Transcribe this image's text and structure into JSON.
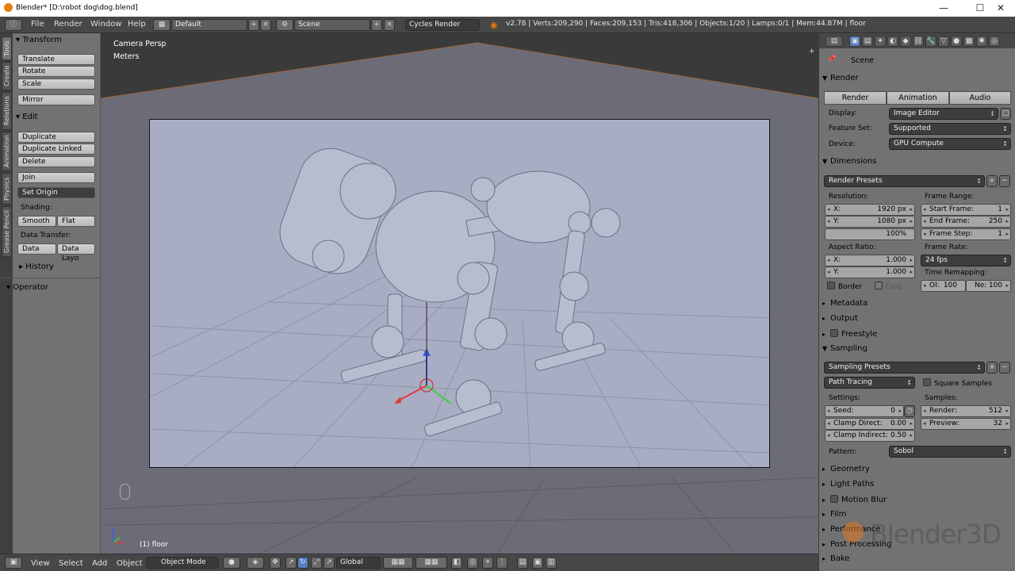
{
  "titlebar": {
    "title": "Blender* [D:\\robot dog\\dog.blend]",
    "minimize": "—",
    "maximize": "☐",
    "close": "✕"
  },
  "infobar": {
    "menus": [
      "File",
      "Render",
      "Window",
      "Help"
    ],
    "screen_layout": "Default",
    "scene": "Scene",
    "render_engine": "Cycles Render",
    "stats": "v2.78 | Verts:209,290 | Faces:209,153 | Tris:418,306 | Objects:1/20 | Lamps:0/1 | Mem:44.87M | floor"
  },
  "tool_tabs": [
    "Tools",
    "Create",
    "Relations",
    "Animation",
    "Physics",
    "Grease Pencil"
  ],
  "toolshelf": {
    "transform_title": "Transform",
    "translate": "Translate",
    "rotate": "Rotate",
    "scale": "Scale",
    "mirror": "Mirror",
    "edit_title": "Edit",
    "duplicate": "Duplicate",
    "duplicate_linked": "Duplicate Linked",
    "delete": "Delete",
    "join": "Join",
    "set_origin": "Set Origin",
    "shading_label": "Shading:",
    "smooth": "Smooth",
    "flat": "Flat",
    "data_transfer_label": "Data Transfer:",
    "data": "Data",
    "data_layout": "Data Layo",
    "history_title": "History",
    "operator_title": "Operator"
  },
  "viewport": {
    "view_name": "Camera Persp",
    "units": "Meters",
    "object_label": "(1) floor"
  },
  "bottombar": {
    "view": "View",
    "select": "Select",
    "add": "Add",
    "object": "Object",
    "mode": "Object Mode",
    "orientation": "Global"
  },
  "props": {
    "context": "Scene",
    "render_title": "Render",
    "render_btn": "Render",
    "animation_btn": "Animation",
    "audio_btn": "Audio",
    "display_label": "Display:",
    "display_value": "Image Editor",
    "feature_set_label": "Feature Set:",
    "feature_set_value": "Supported",
    "device_label": "Device:",
    "device_value": "GPU Compute",
    "dimensions_title": "Dimensions",
    "render_presets": "Render Presets",
    "resolution_label": "Resolution:",
    "res_x_label": "X:",
    "res_x": "1920 px",
    "res_y_label": "Y:",
    "res_y": "1080 px",
    "res_pct": "100%",
    "frame_range_label": "Frame Range:",
    "start_frame_label": "Start Frame:",
    "start_frame": "1",
    "end_frame_label": "End Frame:",
    "end_frame": "250",
    "frame_step_label": "Frame Step:",
    "frame_step": "1",
    "aspect_label": "Aspect Ratio:",
    "asp_x_label": "X:",
    "asp_x": "1.000",
    "asp_y_label": "Y:",
    "asp_y": "1.000",
    "frame_rate_label": "Frame Rate:",
    "frame_rate": "24 fps",
    "time_remap_label": "Time Remapping:",
    "old_label": "Ol:",
    "old": "100",
    "new_label": "Ne:",
    "new": "100",
    "border": "Border",
    "crop": "Crop",
    "metadata_title": "Metadata",
    "output_title": "Output",
    "freestyle_title": "Freestyle",
    "sampling_title": "Sampling",
    "sampling_presets": "Sampling Presets",
    "integrator": "Path Tracing",
    "square_samples": "Square Samples",
    "settings_label": "Settings:",
    "samples_label": "Samples:",
    "seed_label": "Seed:",
    "seed": "0",
    "clamp_direct_label": "Clamp Direct:",
    "clamp_direct": "0.00",
    "clamp_indirect_label": "Clamp Indirect:",
    "clamp_indirect": "0.50",
    "render_samples_label": "Render:",
    "render_samples": "512",
    "preview_samples_label": "Preview:",
    "preview_samples": "32",
    "pattern_label": "Pattern:",
    "pattern_value": "Sobol",
    "geometry_title": "Geometry",
    "light_paths_title": "Light Paths",
    "motion_blur_title": "Motion Blur",
    "film_title": "Film",
    "performance_title": "Performance",
    "post_processing_title": "Post Processing",
    "bake_title": "Bake"
  },
  "watermark": "Blender3D"
}
